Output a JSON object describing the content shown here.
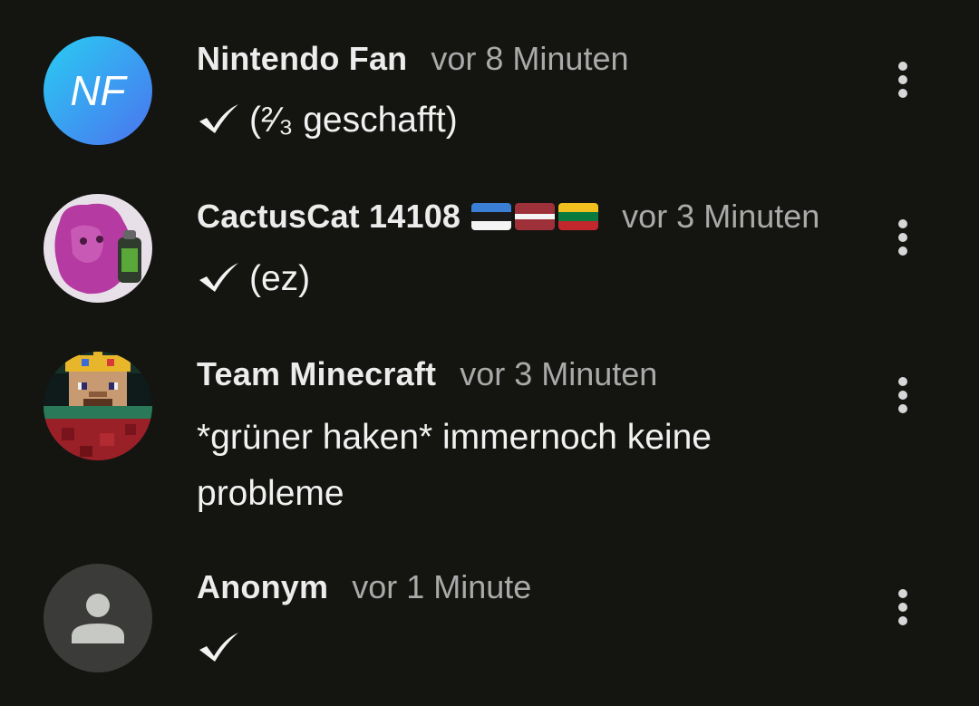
{
  "comments": [
    {
      "author": "Nintendo Fan",
      "time": "vor 8 Minuten",
      "text": "(²⁄₃ geschafft)",
      "avatar_initials": "NF",
      "has_check": true
    },
    {
      "author": "CactusCat 14108",
      "time": "vor 3 Minuten",
      "text": "(ez)",
      "flags": [
        "estonia-flag",
        "latvia-flag",
        "lithuania-flag"
      ],
      "has_check": true
    },
    {
      "author": "Team Minecraft",
      "time": "vor 3 Minuten",
      "text": "*grüner haken* immernoch keine probleme",
      "has_check": false
    },
    {
      "author": "Anonym",
      "time": "vor 1 Minute",
      "text": "",
      "has_check": true
    }
  ],
  "icons": {
    "check": "check-mark-icon",
    "more": "more-vertical-icon",
    "person": "person-icon"
  },
  "colors": {
    "background": "#141411",
    "author": "#ececec",
    "timestamp": "#aaaaaa",
    "body_text": "#f1f1f1",
    "nf_avatar_gradient": [
      "#2ec4f0",
      "#4a7cf2"
    ],
    "anon_avatar_bg": "#3b3c39",
    "anon_avatar_fg": "#c7c9c5"
  }
}
